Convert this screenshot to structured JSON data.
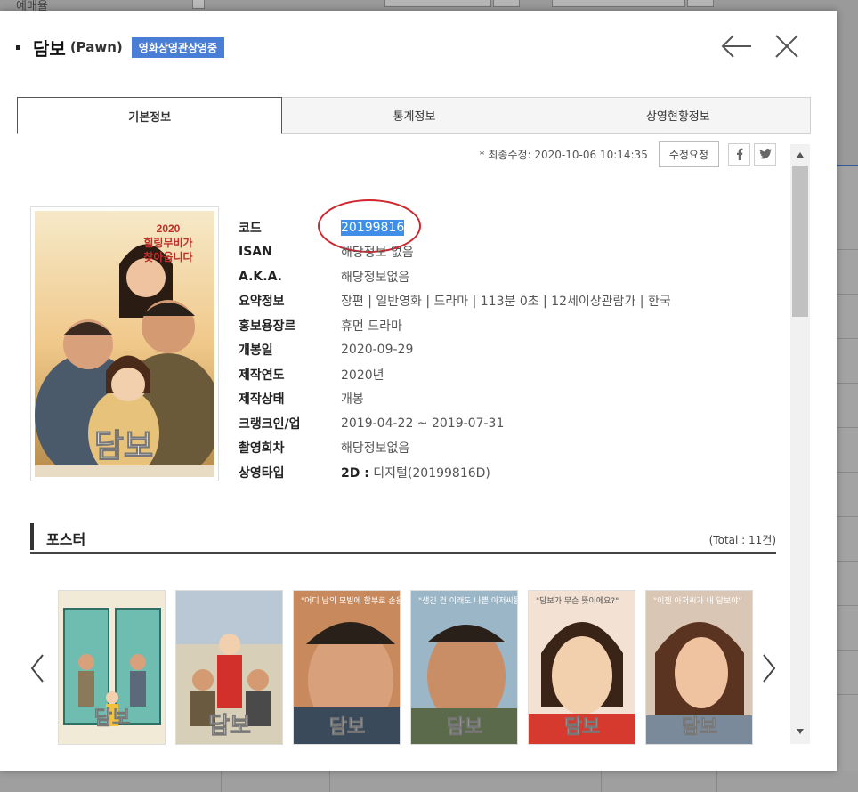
{
  "background": {
    "top_label": "예매율"
  },
  "modal": {
    "title": "담보",
    "title_en": "(Pawn)",
    "badge": "영화상영관상영중",
    "tabs": [
      {
        "label": "기본정보",
        "active": true
      },
      {
        "label": "통계정보",
        "active": false
      },
      {
        "label": "상영현황정보",
        "active": false
      }
    ],
    "updated": "* 최종수정: 2020-10-06 10:14:35",
    "edit_button": "수정요청",
    "social": [
      "facebook-icon",
      "twitter-icon"
    ]
  },
  "poster": {
    "top_text_1": "2020",
    "top_text_2": "힐링무비가",
    "top_text_3": "찾아옵니다",
    "logo_text": "담보"
  },
  "info": {
    "rows": [
      {
        "key": "코드",
        "value": "20199816"
      },
      {
        "key": "ISAN",
        "value": "해당정보 없음"
      },
      {
        "key": "A.K.A.",
        "value": "해당정보없음"
      },
      {
        "key": "요약정보",
        "value": "장편 | 일반영화 | 드라마 | 113분 0초 | 12세이상관람가 | 한국"
      },
      {
        "key": "홍보용장르",
        "value": "휴먼 드라마"
      },
      {
        "key": "개봉일",
        "value": "2020-09-29"
      },
      {
        "key": "제작연도",
        "value": "2020년"
      },
      {
        "key": "제작상태",
        "value": "개봉"
      },
      {
        "key": "크랭크인/업",
        "value": "2019-04-22 ~ 2019-07-31"
      },
      {
        "key": "촬영회차",
        "value": "해당정보없음"
      },
      {
        "key": "상영타입",
        "value_bold": "2D :",
        "value": " 디지털(20199816D)"
      }
    ]
  },
  "posters_section": {
    "title": "포스터",
    "total": "(Total : 11건)",
    "thumbs": [
      {
        "logo": "담보",
        "quote": ""
      },
      {
        "logo": "담보",
        "quote": ""
      },
      {
        "logo": "담보",
        "quote": "\"어디 남의 모빌에 함부로 손을 대?\""
      },
      {
        "logo": "담보",
        "quote": "\"생긴 건 이래도 나쁜 아저씨들 아니거든?\""
      },
      {
        "logo": "담보",
        "quote": "\"담보가 무슨 뜻이에요?\""
      },
      {
        "logo": "담보",
        "quote": "\"이젠 아저씨가 내 담보야\""
      }
    ]
  },
  "colors": {
    "badge": "#4a7ed6",
    "highlight": "#3f8fe8",
    "annotation": "#d0262d"
  }
}
